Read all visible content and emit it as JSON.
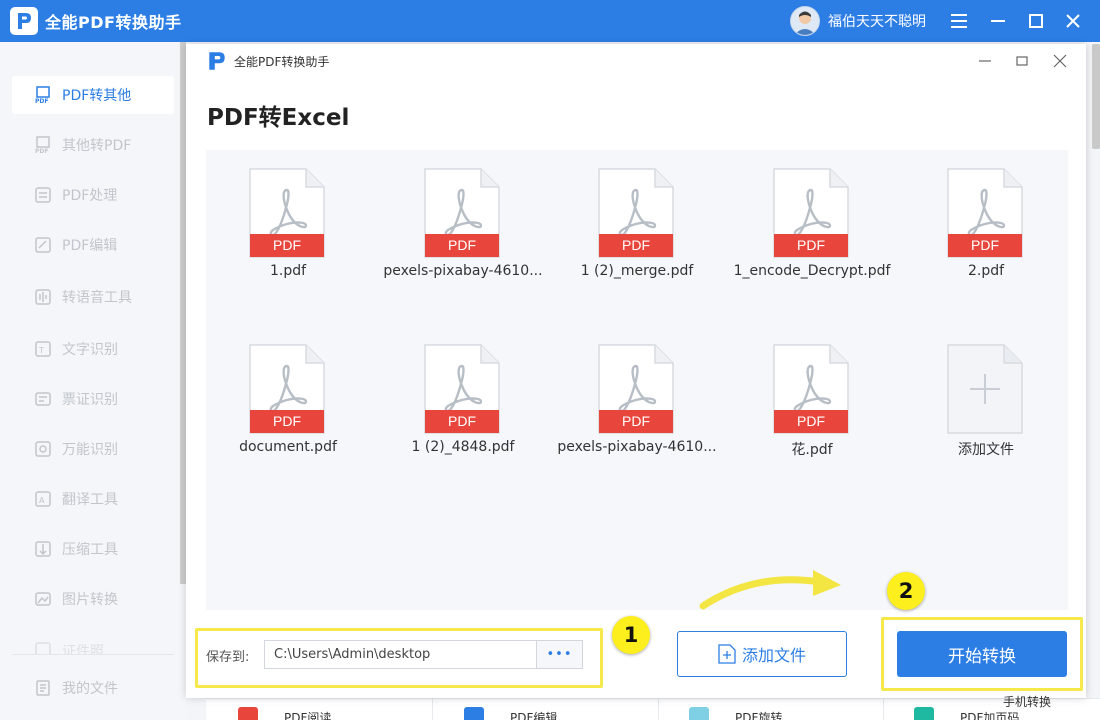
{
  "app": {
    "title": "全能PDF转换助手",
    "user_name": "福伯天天不聪明",
    "accent": "#2c7ee5",
    "highlight": "#f6e94c"
  },
  "sidebar": {
    "items": [
      {
        "label": "PDF转其他",
        "icon": "pdf-convert-icon"
      },
      {
        "label": "其他转PDF",
        "icon": "to-pdf-icon"
      },
      {
        "label": "PDF处理",
        "icon": "pdf-process-icon"
      },
      {
        "label": "PDF编辑",
        "icon": "pdf-edit-icon"
      },
      {
        "label": "转语音工具",
        "icon": "speech-icon"
      },
      {
        "label": "文字识别",
        "icon": "ocr-icon"
      },
      {
        "label": "票证识别",
        "icon": "ticket-icon"
      },
      {
        "label": "万能识别",
        "icon": "universal-recognition-icon"
      },
      {
        "label": "翻译工具",
        "icon": "translate-icon"
      },
      {
        "label": "压缩工具",
        "icon": "compress-icon"
      },
      {
        "label": "图片转换",
        "icon": "image-convert-icon"
      },
      {
        "label": "证件照",
        "icon": "id-photo-icon"
      },
      {
        "label": "我的文件",
        "icon": "my-files-icon"
      }
    ]
  },
  "dialog": {
    "window_title": "全能PDF转换助手",
    "page_title": "PDF转Excel",
    "file_badge": "PDF",
    "files": [
      {
        "name": "1.pdf"
      },
      {
        "name": "pexels-pixabay-4610..."
      },
      {
        "name": "1 (2)_merge.pdf"
      },
      {
        "name": "1_encode_Decrypt.pdf"
      },
      {
        "name": "2.pdf"
      },
      {
        "name": "document.pdf"
      },
      {
        "name": "1 (2)_4848.pdf"
      },
      {
        "name": "pexels-pixabay-4610..."
      },
      {
        "name": "花.pdf"
      }
    ],
    "add_tile_label": "添加文件"
  },
  "bottom": {
    "save_label": "保存到:",
    "save_path": "C:\\Users\\Admin\\desktop",
    "browse_label": "•••",
    "add_file_label": "添加文件",
    "start_label": "开始转换",
    "step1": "1",
    "step2": "2",
    "phone_label": "手机转换"
  },
  "strip": [
    "PDF阅读",
    "PDF编辑",
    "PDF旋转",
    "PDF加页码"
  ]
}
